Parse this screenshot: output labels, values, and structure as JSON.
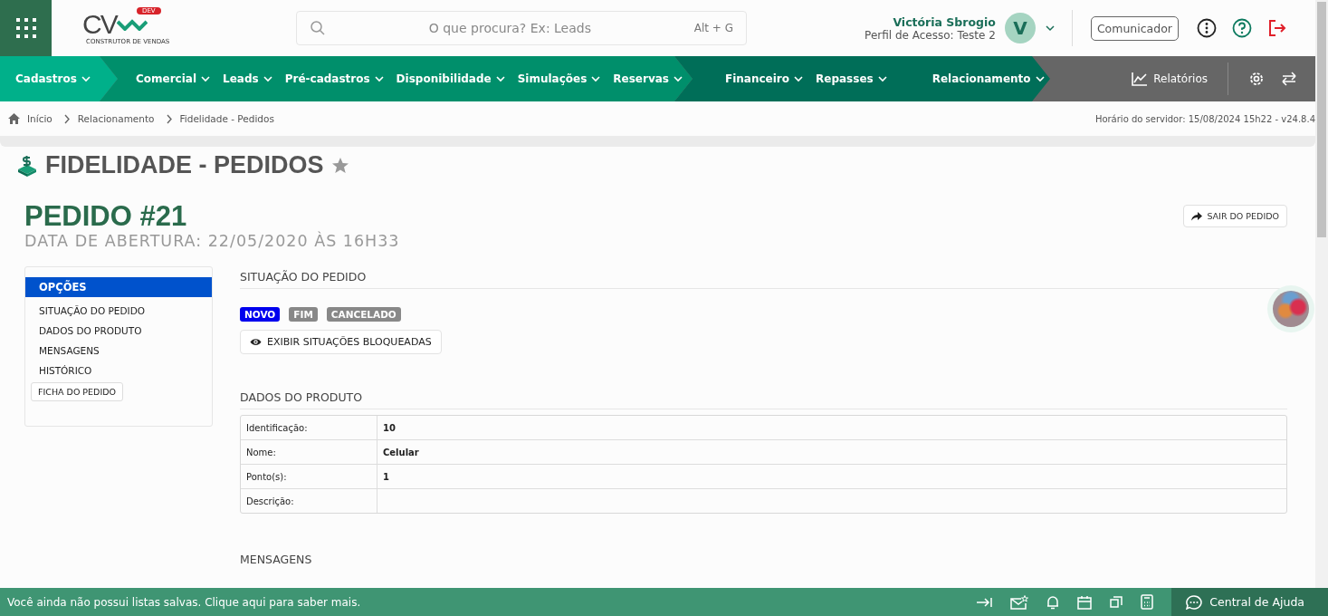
{
  "header": {
    "logo": {
      "text": "CV",
      "badge": "DEV",
      "caption": "CONSTRUTOR DE VENDAS"
    },
    "search": {
      "placeholder": "O que procura? Ex: Leads",
      "shortcut": "Alt + G"
    },
    "user": {
      "name": "Victória Sbrogio",
      "profile": "Perfil de Acesso: Teste 2",
      "initial": "V"
    },
    "communicator": "Comunicador"
  },
  "nav": {
    "groups": [
      {
        "color": "#00b08a",
        "items": [
          "Cadastros"
        ]
      },
      {
        "color": "#008f6b",
        "items": [
          "Comercial",
          "Leads",
          "Pré-cadastros",
          "Disponibilidade",
          "Simulações",
          "Reservas"
        ]
      },
      {
        "color": "#006e58",
        "items": [
          "Financeiro",
          "Repasses",
          "Relacionamento"
        ]
      }
    ],
    "reports": "Relatórios"
  },
  "breadcrumb": [
    "Início",
    "Relacionamento",
    "Fidelidade - Pedidos"
  ],
  "server_time": "Horário do servidor: 15/08/2024 15h22 - v24.8.4",
  "page_title": "FIDELIDADE - PEDIDOS",
  "order": {
    "title": "PEDIDO #21",
    "subtitle": "DATA DE ABERTURA: 22/05/2020 ÀS 16H33",
    "exit_button": "SAIR DO PEDIDO"
  },
  "options": {
    "header": "OPÇÕES",
    "items": [
      "SITUAÇÃO DO PEDIDO",
      "DADOS DO PRODUTO",
      "MENSAGENS",
      "HISTÓRICO"
    ],
    "button": "FICHA DO PEDIDO"
  },
  "status_section": {
    "heading": "SITUAÇÃO DO PEDIDO",
    "statuses": [
      {
        "label": "NOVO",
        "selected": true
      },
      {
        "label": "FIM",
        "selected": false
      },
      {
        "label": "CANCELADO",
        "selected": false
      }
    ],
    "button": "EXIBIR SITUAÇÕES BLOQUEADAS"
  },
  "product_section": {
    "heading": "DADOS DO PRODUTO",
    "rows": [
      {
        "label": "Identificação:",
        "value": "10"
      },
      {
        "label": "Nome:",
        "value": "Celular"
      },
      {
        "label": "Ponto(s):",
        "value": "1"
      },
      {
        "label": "Descrição:"
      }
    ]
  },
  "messages_heading": "MENSAGENS",
  "footer": {
    "message": "Você ainda não possui listas salvas. Clique aqui para saber mais.",
    "help": "Central de Ajuda"
  }
}
